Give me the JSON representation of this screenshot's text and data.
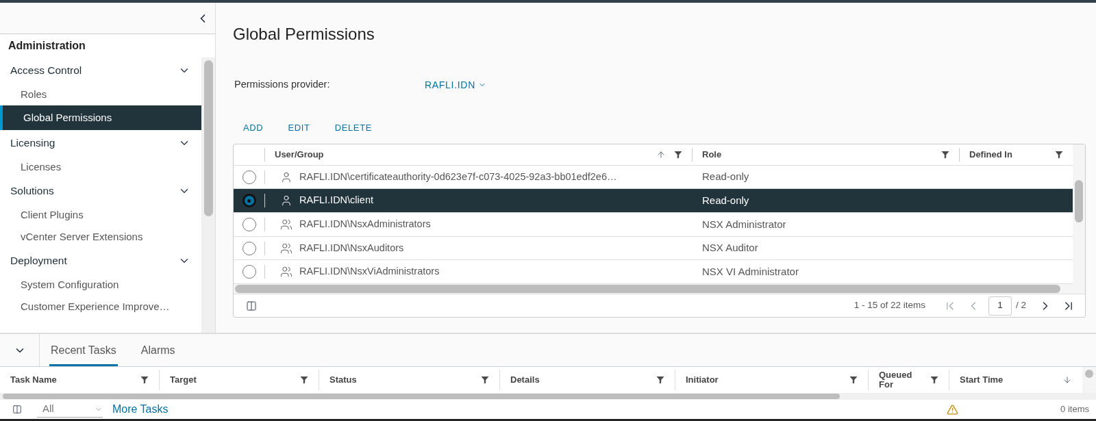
{
  "sidebar": {
    "title": "Administration",
    "groups": [
      {
        "label": "Access Control",
        "expanded": true,
        "items": [
          {
            "label": "Roles",
            "selected": false
          },
          {
            "label": "Global Permissions",
            "selected": true
          }
        ]
      },
      {
        "label": "Licensing",
        "expanded": true,
        "items": [
          {
            "label": "Licenses",
            "selected": false
          }
        ]
      },
      {
        "label": "Solutions",
        "expanded": true,
        "items": [
          {
            "label": "Client Plugins",
            "selected": false
          },
          {
            "label": "vCenter Server Extensions",
            "selected": false
          }
        ]
      },
      {
        "label": "Deployment",
        "expanded": true,
        "items": [
          {
            "label": "System Configuration",
            "selected": false
          },
          {
            "label": "Customer Experience Improve…",
            "selected": false
          }
        ]
      }
    ]
  },
  "main": {
    "title": "Global Permissions",
    "provider": {
      "label": "Permissions provider:",
      "value": "RAFLI.IDN"
    },
    "actions": [
      "ADD",
      "EDIT",
      "DELETE"
    ],
    "table": {
      "columns": [
        {
          "label": "User/Group",
          "sorted": true,
          "descending": false,
          "filter": true
        },
        {
          "label": "Role",
          "sorted": false,
          "filter": true
        },
        {
          "label": "Defined In",
          "sorted": false,
          "filter": true
        }
      ],
      "rows": [
        {
          "kind": "user",
          "name": "RAFLI.IDN\\certificateauthority-0d623e7f-c073-4025-92a3-bb01edf2e6…",
          "role": "Read-only",
          "selected": false
        },
        {
          "kind": "user",
          "name": "RAFLI.IDN\\client",
          "role": "Read-only",
          "selected": true
        },
        {
          "kind": "group",
          "name": "RAFLI.IDN\\NsxAdministrators",
          "role": "NSX Administrator",
          "selected": false
        },
        {
          "kind": "group",
          "name": "RAFLI.IDN\\NsxAuditors",
          "role": "NSX Auditor",
          "selected": false
        },
        {
          "kind": "group",
          "name": "RAFLI.IDN\\NsxViAdministrators",
          "role": "NSX VI Administrator",
          "selected": false
        }
      ],
      "footer": {
        "count": "1 - 15 of 22 items",
        "page": "1",
        "pages": "/ 2"
      }
    }
  },
  "bottom": {
    "tabs": [
      {
        "label": "Recent Tasks",
        "selected": true
      },
      {
        "label": "Alarms",
        "selected": false
      }
    ],
    "columns": [
      {
        "label": "Task Name",
        "sorted": false,
        "filter": true
      },
      {
        "label": "Target",
        "sorted": false,
        "filter": true
      },
      {
        "label": "Status",
        "sorted": false,
        "filter": true
      },
      {
        "label": "Details",
        "sorted": false,
        "filter": true
      },
      {
        "label": "Initiator",
        "sorted": false,
        "filter": true
      },
      {
        "label": "Queued For",
        "sorted": false,
        "filter": true
      },
      {
        "label": "Start Time",
        "sorted": true,
        "descending": true,
        "filter": false
      }
    ],
    "filter": "All",
    "link": "More Tasks",
    "count": "0 items"
  }
}
